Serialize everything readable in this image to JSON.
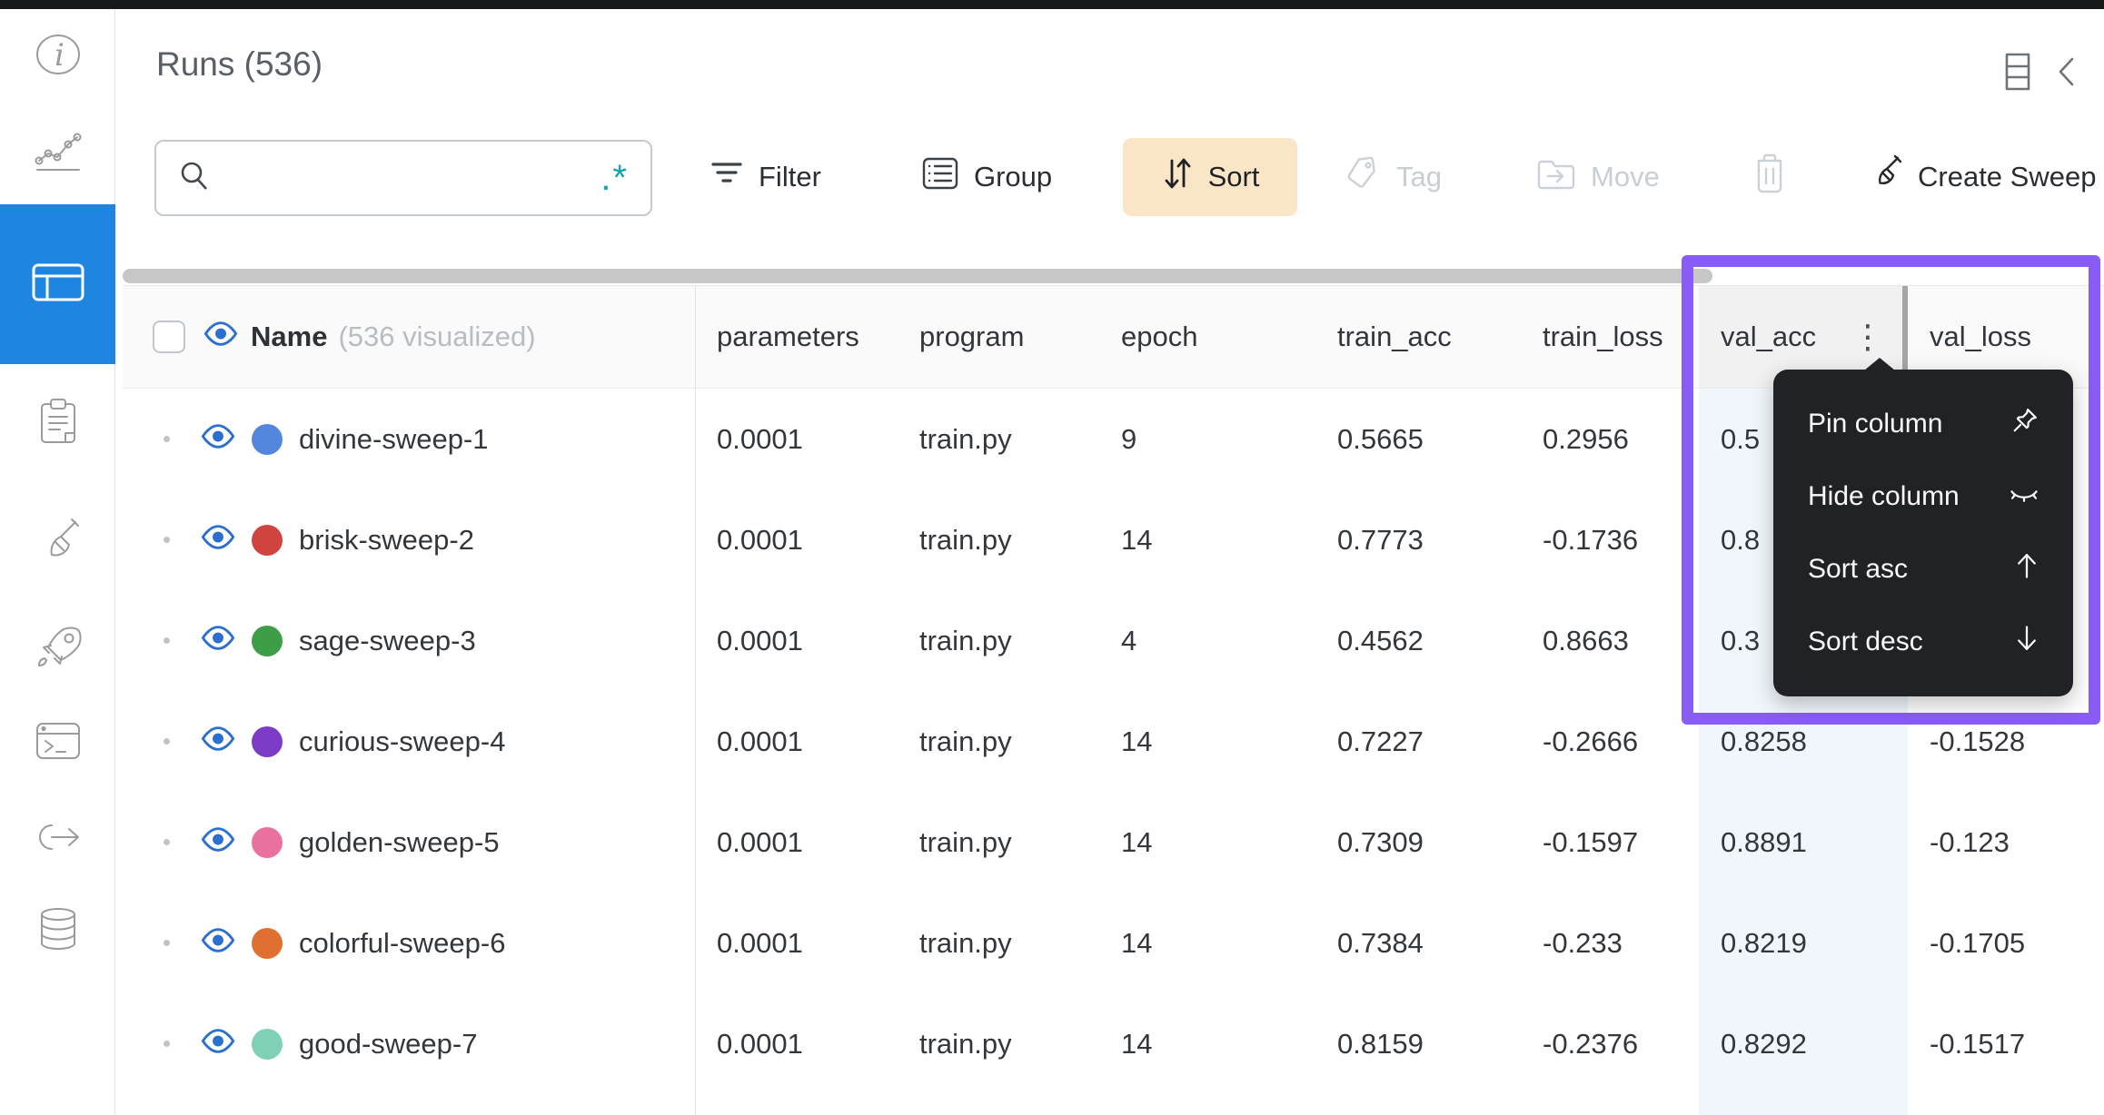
{
  "sidebar": {
    "items": [
      {
        "name": "info"
      },
      {
        "name": "charts"
      },
      {
        "name": "runs-table",
        "active": true
      },
      {
        "name": "notes"
      },
      {
        "name": "sweeps"
      },
      {
        "name": "launch"
      },
      {
        "name": "terminal"
      },
      {
        "name": "links"
      },
      {
        "name": "artifacts"
      }
    ]
  },
  "header": {
    "title": "Runs (536)"
  },
  "toolbar": {
    "search": {
      "placeholder": "",
      "value": "",
      "regex_label": ".*"
    },
    "filter_label": "Filter",
    "group_label": "Group",
    "sort_label": "Sort",
    "tag_label": "Tag",
    "move_label": "Move",
    "create_sweep_label": "Create Sweep"
  },
  "table": {
    "name_column": {
      "label": "Name",
      "suffix": "(536 visualized)"
    },
    "columns": [
      "parameters",
      "program",
      "epoch",
      "train_acc",
      "train_loss",
      "val_acc",
      "val_loss"
    ],
    "rows": [
      {
        "name": "divine-sweep-1",
        "color": "#5387dd",
        "parameters": "0.0001",
        "program": "train.py",
        "epoch": "9",
        "train_acc": "0.5665",
        "train_loss": "0.2956",
        "val_acc": "0.5",
        "val_loss": ""
      },
      {
        "name": "brisk-sweep-2",
        "color": "#d0443f",
        "parameters": "0.0001",
        "program": "train.py",
        "epoch": "14",
        "train_acc": "0.7773",
        "train_loss": "-0.1736",
        "val_acc": "0.8",
        "val_loss": ""
      },
      {
        "name": "sage-sweep-3",
        "color": "#3d9e47",
        "parameters": "0.0001",
        "program": "train.py",
        "epoch": "4",
        "train_acc": "0.4562",
        "train_loss": "0.8663",
        "val_acc": "0.3",
        "val_loss": ""
      },
      {
        "name": "curious-sweep-4",
        "color": "#7d3cc8",
        "parameters": "0.0001",
        "program": "train.py",
        "epoch": "14",
        "train_acc": "0.7227",
        "train_loss": "-0.2666",
        "val_acc": "0.8258",
        "val_loss": "-0.1528"
      },
      {
        "name": "golden-sweep-5",
        "color": "#e8719f",
        "parameters": "0.0001",
        "program": "train.py",
        "epoch": "14",
        "train_acc": "0.7309",
        "train_loss": "-0.1597",
        "val_acc": "0.8891",
        "val_loss": "-0.123"
      },
      {
        "name": "colorful-sweep-6",
        "color": "#df7032",
        "parameters": "0.0001",
        "program": "train.py",
        "epoch": "14",
        "train_acc": "0.7384",
        "train_loss": "-0.233",
        "val_acc": "0.8219",
        "val_loss": "-0.1705"
      },
      {
        "name": "good-sweep-7",
        "color": "#7fd1b5",
        "parameters": "0.0001",
        "program": "train.py",
        "epoch": "14",
        "train_acc": "0.8159",
        "train_loss": "-0.2376",
        "val_acc": "0.8292",
        "val_loss": "-0.1517"
      }
    ]
  },
  "context_menu": {
    "items": [
      {
        "label": "Pin column"
      },
      {
        "label": "Hide column"
      },
      {
        "label": "Sort asc"
      },
      {
        "label": "Sort desc"
      }
    ]
  },
  "colors": {
    "accent_blue": "#1e86e0",
    "eye_blue": "#2b6fcf",
    "sort_button_bg": "#fbe5c7",
    "purple_highlight": "#8a5cf6",
    "menu_bg": "#212226",
    "val_acc_tint": "#f0f6fb",
    "regex_teal": "#0ea5b5"
  }
}
